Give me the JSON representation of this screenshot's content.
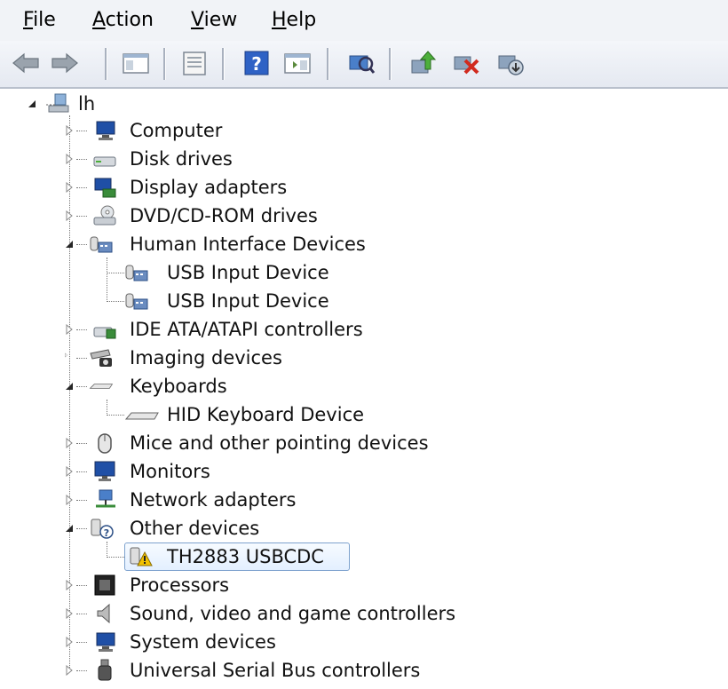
{
  "menu": {
    "file": {
      "underline": "F",
      "rest": "ile"
    },
    "action": {
      "underline": "A",
      "rest": "ction"
    },
    "view": {
      "underline": "V",
      "rest": "iew"
    },
    "help": {
      "underline": "H",
      "rest": "elp"
    }
  },
  "toolbar": {
    "icons": [
      "back-arrow-icon",
      "forward-arrow-icon",
      "show-hide-console-tree-icon",
      "properties-icon",
      "help-icon",
      "show-hide-action-pane-icon",
      "scan-hardware-changes-icon",
      "update-driver-icon",
      "disable-device-icon",
      "uninstall-device-icon"
    ]
  },
  "tree": {
    "root": {
      "label": "lh",
      "icon": "computer-network-icon"
    },
    "categories": [
      {
        "label": "Computer",
        "expanded": false
      },
      {
        "label": "Disk drives",
        "expanded": false
      },
      {
        "label": "Display adapters",
        "expanded": false
      },
      {
        "label": "DVD/CD-ROM drives",
        "expanded": false
      },
      {
        "label": "Human Interface Devices",
        "expanded": true,
        "children": [
          "USB Input Device",
          "USB Input Device"
        ]
      },
      {
        "label": "IDE ATA/ATAPI controllers",
        "expanded": false
      },
      {
        "label": "Imaging devices",
        "expanded": false
      },
      {
        "label": "Keyboards",
        "expanded": true,
        "children": [
          "HID Keyboard Device"
        ]
      },
      {
        "label": "Mice and other pointing devices",
        "expanded": false
      },
      {
        "label": "Monitors",
        "expanded": false
      },
      {
        "label": "Network adapters",
        "expanded": false
      },
      {
        "label": "Other devices",
        "expanded": true,
        "children": [
          "TH2883 USBCDC"
        ]
      },
      {
        "label": "Processors",
        "expanded": false
      },
      {
        "label": "Sound, video and game controllers",
        "expanded": false
      },
      {
        "label": "System devices",
        "expanded": false
      },
      {
        "label": "Universal Serial Bus controllers",
        "expanded": false
      }
    ],
    "selected": "TH2883 USBCDC",
    "colors": {
      "selection_border": "#7da2ce",
      "selection_fill": "#e3efff",
      "warning": "#f2c200"
    }
  }
}
